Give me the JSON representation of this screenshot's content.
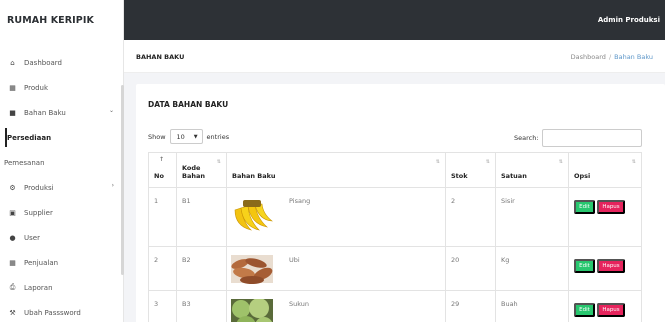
{
  "brand": "RUMAH KERIPIK",
  "topbar": {
    "user": "Admin Produksi"
  },
  "sidebar": {
    "items": [
      {
        "label": "Dashboard",
        "icon": "home-icon"
      },
      {
        "label": "Produk",
        "icon": "cubes-icon"
      },
      {
        "label": "Bahan Baku",
        "icon": "box-icon",
        "expandable": true
      },
      {
        "label": "Persediaan",
        "active": true
      },
      {
        "label": "Pemesanan"
      },
      {
        "label": "Produksi",
        "icon": "gears-icon",
        "expandable": true
      },
      {
        "label": "Supplier",
        "icon": "truck-icon"
      },
      {
        "label": "User",
        "icon": "users-icon"
      },
      {
        "label": "Penjualan",
        "icon": "cubes-icon"
      },
      {
        "label": "Laporan",
        "icon": "print-icon"
      },
      {
        "label": "Ubah Passsword",
        "icon": "wrench-icon"
      }
    ]
  },
  "page": {
    "title": "BAHAN BAKU",
    "breadcrumb": [
      "Dashboard",
      "Bahan Baku"
    ]
  },
  "card": {
    "title": "DATA BAHAN BAKU",
    "show_label": "Show",
    "entries_value": "10",
    "entries_label": "entries",
    "search_label": "Search:",
    "search_value": ""
  },
  "table": {
    "headers": [
      "No",
      "Kode Bahan",
      "Bahan Baku",
      "Stok",
      "Satuan",
      "Opsi"
    ],
    "rows": [
      {
        "no": "1",
        "kode": "B1",
        "nama": "Pisang",
        "stok": "2",
        "satuan": "Sisir",
        "image": "banana"
      },
      {
        "no": "2",
        "kode": "B2",
        "nama": "Ubi",
        "stok": "20",
        "satuan": "Kg",
        "image": "sweet-potato"
      },
      {
        "no": "3",
        "kode": "B3",
        "nama": "Sukun",
        "stok": "29",
        "satuan": "Buah",
        "image": "breadfruit"
      }
    ],
    "edit_label": "Edit",
    "delete_label": "Hapus"
  },
  "colors": {
    "topbar": "#2d3136",
    "edit_button": "#28c76f",
    "delete_button": "#e6245d",
    "breadcrumb_active": "#5e97c9"
  }
}
